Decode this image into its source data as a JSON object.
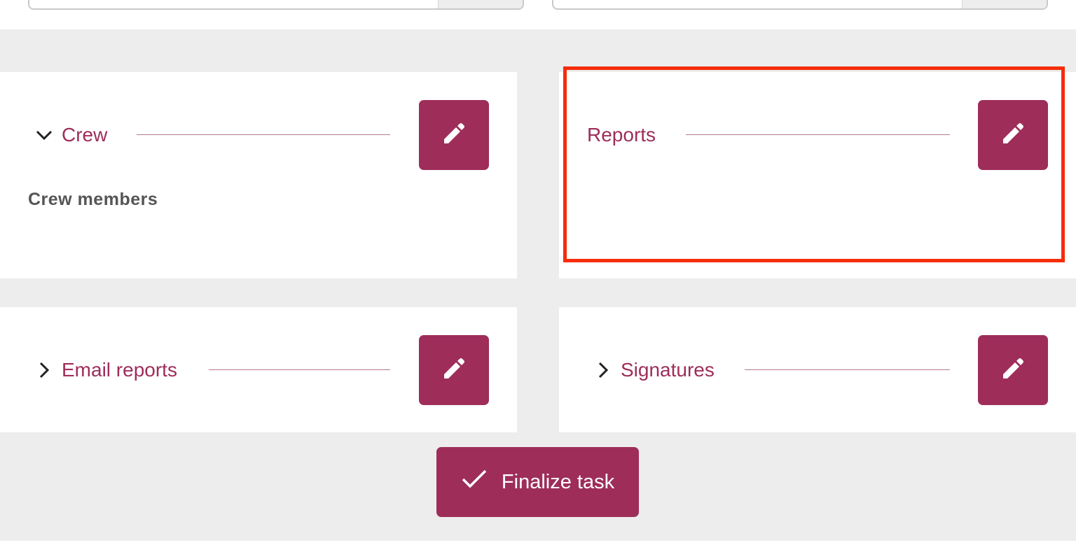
{
  "sections": {
    "crew": {
      "title": "Crew",
      "expanded": true,
      "body_label": "Crew members"
    },
    "reports": {
      "title": "Reports"
    },
    "email_reports": {
      "title": "Email reports",
      "expanded": false
    },
    "signatures": {
      "title": "Signatures",
      "expanded": false
    }
  },
  "actions": {
    "finalize_label": "Finalize task"
  },
  "icons": {
    "edit": "pencil-icon",
    "expanded": "chevron-down-icon",
    "collapsed": "chevron-right-icon",
    "finalize": "checkmark-icon"
  },
  "colors": {
    "accent": "#9e2d5a",
    "divider": "#b9768f",
    "highlight": "#f52d0a",
    "background": "#ededed",
    "body_text": "#555555"
  }
}
